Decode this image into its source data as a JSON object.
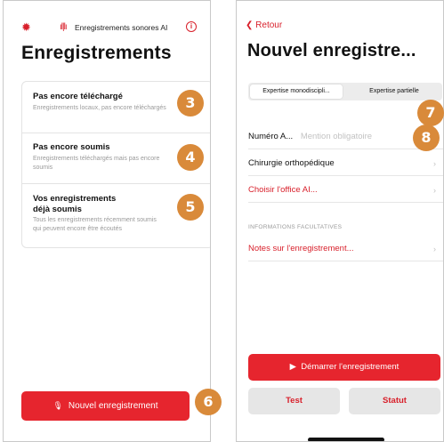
{
  "colors": {
    "accent": "#e6252e",
    "badge": "#d98a3a"
  },
  "screen1": {
    "app_title": "Enregistrements sonores AI",
    "heading": "Enregistrements",
    "cards": [
      {
        "title": "Pas encore téléchargé",
        "description": "Enregistrements locaux, pas encore téléchargés",
        "badge": "3"
      },
      {
        "title": "Pas encore soumis",
        "description": "Enregistrements téléchargés mais pas encore soumis",
        "badge": "4"
      },
      {
        "title": "Vos enregistrements déjà soumis",
        "description": "Tous les enregistrements récemment soumis qui peuvent encore être écoutés",
        "badge": "5"
      }
    ],
    "new_button": "Nouvel enregistrement",
    "new_badge": "6"
  },
  "screen2": {
    "back": "Retour",
    "heading": "Nouvel enregistre...",
    "segments": [
      "Expertise monodiscipli...",
      "Expertise partielle"
    ],
    "segment_badge": "7",
    "number_label": "Numéro A...",
    "number_placeholder": "Mention obligatoire",
    "number_badge": "8",
    "specialty": "Chirurgie orthopédique",
    "choose_office": "Choisir l'office AI...",
    "optional_section": "INFORMATIONS FACULTATIVES",
    "notes": "Notes sur l'enregistrement...",
    "start_button": "Démarrer l'enregistrement",
    "test_button": "Test",
    "status_button": "Statut"
  }
}
